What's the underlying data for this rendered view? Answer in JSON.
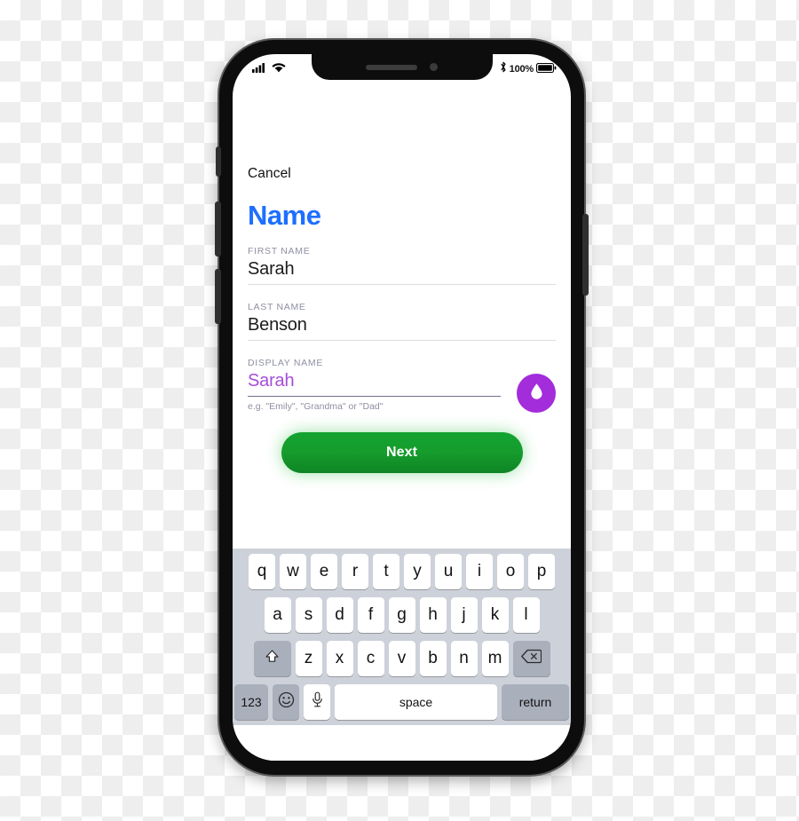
{
  "device": {
    "name": "smartphone-mockup"
  },
  "status_bar": {
    "signal_icon": "cellular-signal-icon",
    "wifi_icon": "wifi-icon",
    "bluetooth_icon": "bluetooth-icon",
    "battery_percent": "100%",
    "battery_icon": "battery-full-icon"
  },
  "screen": {
    "cancel_label": "Cancel",
    "title": "Name",
    "title_color": "#1E6FFF",
    "fields": [
      {
        "label": "FIRST NAME",
        "value": "Sarah",
        "active": false,
        "hint": ""
      },
      {
        "label": "LAST NAME",
        "value": "Benson",
        "active": false,
        "hint": ""
      },
      {
        "label": "DISPLAY NAME",
        "value": "Sarah",
        "active": true,
        "hint": "e.g. \"Emily\", \"Grandma\" or \"Dad\""
      }
    ],
    "accent_button": {
      "icon": "water-drop-icon",
      "color": "#A32CDB"
    },
    "primary_button": {
      "label": "Next",
      "color": "#13A330"
    }
  },
  "keyboard": {
    "row1": [
      "q",
      "w",
      "e",
      "r",
      "t",
      "y",
      "u",
      "i",
      "o",
      "p"
    ],
    "row2": [
      "a",
      "s",
      "d",
      "f",
      "g",
      "h",
      "j",
      "k",
      "l"
    ],
    "row3": [
      "z",
      "x",
      "c",
      "v",
      "b",
      "n",
      "m"
    ],
    "shift_icon": "shift-arrow-icon",
    "backspace_icon": "backspace-delete-icon",
    "numbers_label": "123",
    "emoji_icon": "emoji-smiley-icon",
    "microphone_icon": "microphone-icon",
    "space_label": "space",
    "return_label": "return"
  }
}
